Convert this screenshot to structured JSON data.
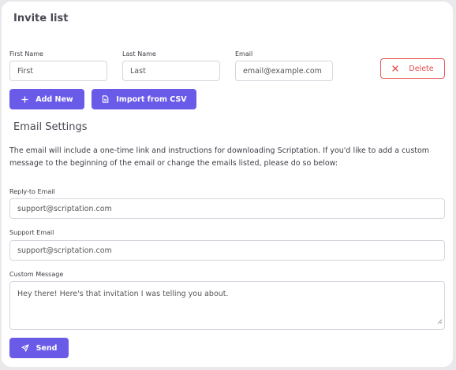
{
  "invite": {
    "title": "Invite list",
    "first_name_label": "First Name",
    "first_name_placeholder": "First",
    "last_name_label": "Last Name",
    "last_name_placeholder": "Last",
    "email_label": "Email",
    "email_placeholder": "email@example.com",
    "delete_label": "Delete",
    "add_new_label": "Add New",
    "import_label": "Import from CSV"
  },
  "settings": {
    "title": "Email Settings",
    "description": "The email will include a one-time link and instructions for downloading Scriptation. If you'd like to add a custom message to the beginning of the email or change the emails listed, please do so below:",
    "reply_to_label": "Reply-to Email",
    "reply_to_value": "support@scriptation.com",
    "support_label": "Support Email",
    "support_value": "support@scriptation.com",
    "custom_label": "Custom Message",
    "custom_value": "Hey there! Here's that invitation I was telling you about.",
    "send_label": "Send"
  },
  "colors": {
    "accent": "#6a5ae8",
    "danger": "#e34b4b"
  }
}
